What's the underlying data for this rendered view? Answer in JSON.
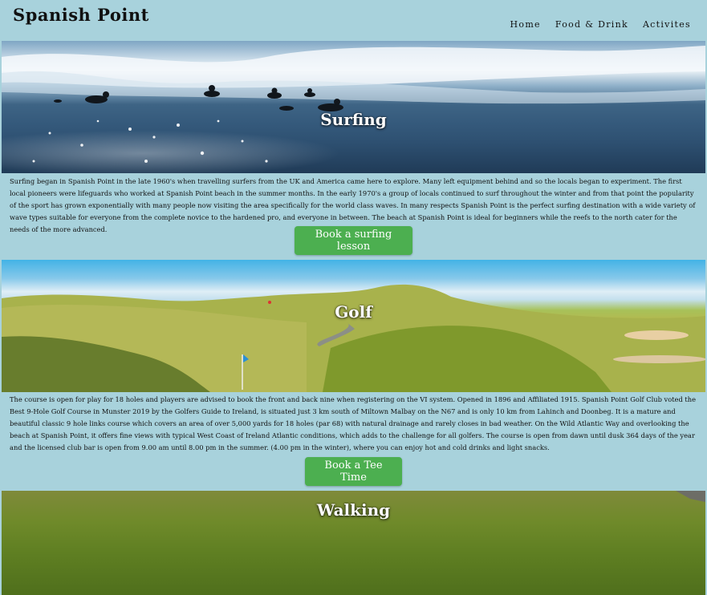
{
  "header": {
    "logo": "Spanish Point",
    "nav": [
      "Home",
      "Food & Drink",
      "Activites"
    ]
  },
  "surfing": {
    "title": "Surfing",
    "text": "Surfing began in Spanish Point in the late 1960's when travelling surfers from the UK and America came here to explore. Many left equipment behind and so the locals began to experiment. The first local pioneers were lifeguards who worked at Spanish Point beach in the summer months. In the early 1970's a group of locals continued to surf throughout the winter and from that point the popularity of the sport has grown exponentially with many people now visiting the area specifically for the world class waves. In many respects Spanish Point is the perfect surfing destination with a wide variety of wave types suitable for everyone from the complete novice to the hardened pro, and everyone in between. The beach at Spanish Point is ideal for beginners while the reefs to the north cater for the needs of the more advanced.",
    "button": "Book a surfing lesson"
  },
  "golf": {
    "title": "Golf",
    "text": "The course is open for play for 18 holes and players are advised to book the front and back nine when registering on the VI system. Opened in 1896 and Affiliated 1915. Spanish Point Golf Club voted the Best 9-Hole Golf Course in Munster 2019 by the Golfers Guide to Ireland, is situated just 3 km south of Miltown Malbay on the N67 and is only 10 km from Lahinch and Doonbeg. It is a mature and beautiful classic 9 hole links course which covers an area of over 5,000 yards for 18 holes (par 68) with natural drainage and rarely closes in bad weather. On the Wild Atlantic Way and overlooking the beach at Spanish Point, it offers fine views with typical West Coast of Ireland Atlantic conditions, which adds to the challenge for all golfers. The course is open from dawn until dusk 364 days of the year and the licensed club bar is open from 9.00 am until 8.00 pm in the summer. (4.00 pm in the winter), where you can enjoy hot and cold drinks and light snacks.",
    "button": "Book a Tee Time"
  },
  "walking": {
    "title": "Walking"
  }
}
